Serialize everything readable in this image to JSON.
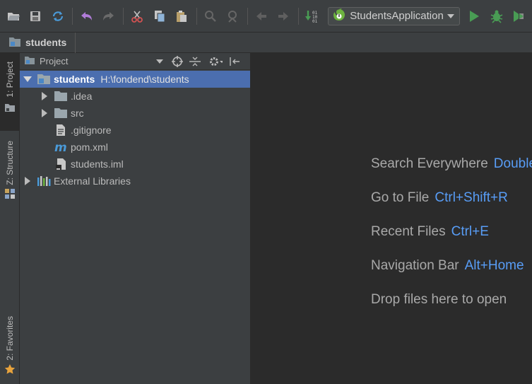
{
  "toolbar": {
    "run_config": "StudentsApplication",
    "icons": [
      "open-folder-icon",
      "save-icon",
      "sync-icon",
      "undo-icon",
      "redo-icon",
      "cut-icon",
      "copy-icon",
      "paste-icon",
      "find-icon",
      "replace-icon",
      "back-icon",
      "forward-icon",
      "build-icon",
      "run-config-dropdown",
      "run-icon",
      "debug-icon",
      "coverage-icon"
    ]
  },
  "navbar": {
    "crumb": "students"
  },
  "stripe": {
    "project_tab": "1: Project",
    "structure_tab": "Z: Structure",
    "favorites_tab": "2: Favorites"
  },
  "project_panel": {
    "title": "Project",
    "tree": [
      {
        "label": "students",
        "path": "H:\\fondend\\students"
      },
      {
        "label": ".idea"
      },
      {
        "label": "src"
      },
      {
        "label": ".gitignore"
      },
      {
        "label": "pom.xml"
      },
      {
        "label": "students.iml"
      },
      {
        "label": "External Libraries"
      }
    ]
  },
  "editor": {
    "hints": [
      {
        "label": "Search Everywhere",
        "key": "Double Shift"
      },
      {
        "label": "Go to File",
        "key": "Ctrl+Shift+R"
      },
      {
        "label": "Recent Files",
        "key": "Ctrl+E"
      },
      {
        "label": "Navigation Bar",
        "key": "Alt+Home"
      },
      {
        "label": "Drop files here to open",
        "key": ""
      }
    ]
  },
  "colors": {
    "accent": "#589df6",
    "selection": "#4b6eaf",
    "run_green": "#499c54",
    "undo_purple": "#b07cd8"
  }
}
